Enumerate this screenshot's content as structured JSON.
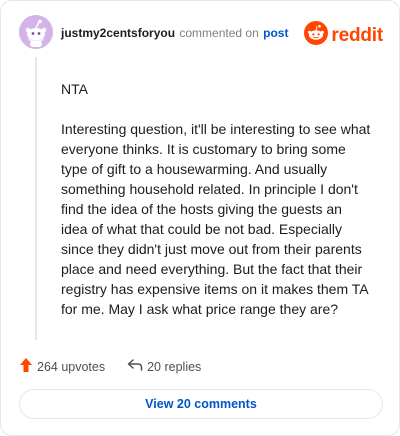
{
  "comment": {
    "username": "justmy2centsforyou",
    "action_text": "commented on",
    "target_link": "post",
    "paragraphs": [
      "NTA",
      "Interesting question, it'll be interesting to see what everyone thinks. It is customary to bring some type of gift to a housewarming. And usually something household related. In principle I don't find the idea of the hosts giving the guests an idea of what that could be not bad. Especially since they didn't just move out from their parents place and need everything. But the fact that their registry has expensive items on it makes them TA for me. May I ask what price range they are?"
    ]
  },
  "brand": {
    "wordmark": "reddit",
    "icon": "reddit-snoo-icon",
    "color": "#ff4500"
  },
  "avatar": {
    "icon": "snoo-avatar-icon",
    "color": "#c9a6e0"
  },
  "actions": {
    "upvotes_label": "264 upvotes",
    "upvote_icon": "upvote-arrow-icon",
    "replies_label": "20 replies",
    "reply_icon": "reply-arrow-icon"
  },
  "footer": {
    "view_comments_label": "View 20 comments"
  },
  "colors": {
    "link": "#0055c8",
    "upvote": "#ff4500",
    "border": "#e4e7ea"
  }
}
